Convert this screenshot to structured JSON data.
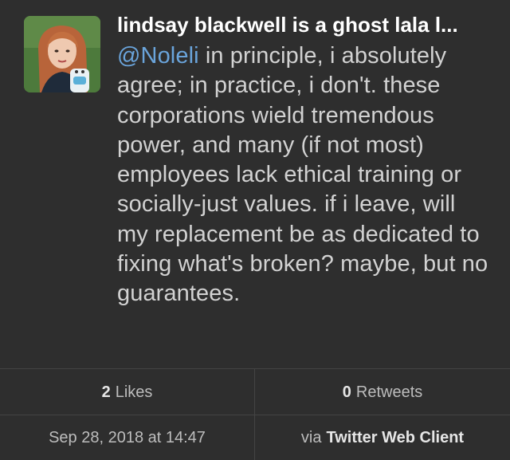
{
  "tweet": {
    "author": "lindsay blackwell is a ghost lala l...",
    "mention": "@Noleli",
    "text": " in principle, i absolutely agree; in practice, i don't. these corporations wield tremendous power, and many (if not most) employees lack ethical training or socially-just values. if i leave, will my replacement be as dedicated to fixing what's broken? maybe, but no guarantees."
  },
  "stats": {
    "likes_count": "2",
    "likes_label": "Likes",
    "retweets_count": "0",
    "retweets_label": "Retweets"
  },
  "meta": {
    "timestamp": "Sep 28, 2018 at 14:47",
    "via_label": "via",
    "client": "Twitter Web Client"
  },
  "colors": {
    "background": "#2e2e2e",
    "mention": "#6aa4db",
    "author": "#ffffff"
  }
}
